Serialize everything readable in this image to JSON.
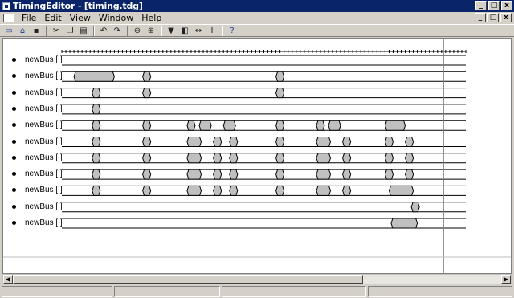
{
  "window": {
    "title": "TimingEditor - [timing.tdg]",
    "controls": [
      "_",
      "□",
      "x"
    ]
  },
  "menu": {
    "items": [
      {
        "first": "F",
        "rest": "ile"
      },
      {
        "first": "E",
        "rest": "dit"
      },
      {
        "first": "V",
        "rest": "iew"
      },
      {
        "first": "W",
        "rest": "indow"
      },
      {
        "first": "H",
        "rest": "elp"
      }
    ]
  },
  "toolbar": {
    "groups": [
      [
        {
          "name": "new-icon",
          "glyph": "▭"
        },
        {
          "name": "open-icon",
          "glyph": "⌂"
        },
        {
          "name": "save-icon",
          "glyph": "▪"
        }
      ],
      [
        {
          "name": "cut-icon",
          "glyph": "✂"
        },
        {
          "name": "copy-icon",
          "glyph": "❐"
        },
        {
          "name": "paste-icon",
          "glyph": "▤"
        }
      ],
      [
        {
          "name": "undo-icon",
          "glyph": "↶"
        },
        {
          "name": "redo-icon",
          "glyph": "↷"
        }
      ],
      [
        {
          "name": "zoom-out-icon",
          "glyph": "⊖"
        },
        {
          "name": "zoom-in-icon",
          "glyph": "⊕"
        }
      ],
      [
        {
          "name": "marker-down-icon",
          "glyph": "▼"
        },
        {
          "name": "add-signal-icon",
          "glyph": "◧"
        },
        {
          "name": "insert-time-icon",
          "glyph": "↔"
        },
        {
          "name": "text-cursor-icon",
          "glyph": "I"
        }
      ],
      [
        {
          "name": "help-icon",
          "glyph": "?"
        }
      ]
    ]
  },
  "signals": {
    "label": "newBus [ ]",
    "count": 11
  },
  "timeline": {
    "t_max": 100,
    "cursor_time": 94.5,
    "rows": [
      [],
      [
        [
          3,
          13
        ],
        [
          20,
          22
        ],
        [
          53,
          55
        ]
      ],
      [
        [
          7.5,
          9.5
        ],
        [
          20,
          22
        ],
        [
          53,
          55
        ]
      ],
      [
        [
          7.5,
          9.5
        ]
      ],
      [
        [
          7.5,
          9.5
        ],
        [
          20,
          22
        ],
        [
          31,
          33
        ],
        [
          34,
          37
        ],
        [
          40,
          43
        ],
        [
          53,
          55
        ],
        [
          63,
          65
        ],
        [
          66,
          69
        ],
        [
          80,
          85
        ]
      ],
      [
        [
          7.5,
          9.5
        ],
        [
          20,
          22
        ],
        [
          31,
          34.5
        ],
        [
          37.5,
          39.5
        ],
        [
          41.5,
          43.5
        ],
        [
          53,
          55
        ],
        [
          63,
          66.5
        ],
        [
          69.5,
          71.5
        ],
        [
          80,
          82
        ],
        [
          85,
          87
        ]
      ],
      [
        [
          7.5,
          9.5
        ],
        [
          20,
          22
        ],
        [
          31,
          34.5
        ],
        [
          37.5,
          39.5
        ],
        [
          41.5,
          43.5
        ],
        [
          53,
          55
        ],
        [
          63,
          66.5
        ],
        [
          69.5,
          71.5
        ],
        [
          80,
          82
        ],
        [
          85,
          87
        ]
      ],
      [
        [
          7.5,
          9.5
        ],
        [
          20,
          22
        ],
        [
          31,
          34.5
        ],
        [
          37.5,
          39.5
        ],
        [
          41.5,
          43.5
        ],
        [
          53,
          55
        ],
        [
          63,
          66.5
        ],
        [
          69.5,
          71.5
        ],
        [
          80,
          82
        ],
        [
          85,
          87
        ]
      ],
      [
        [
          7.5,
          9.5
        ],
        [
          20,
          22
        ],
        [
          31,
          34.5
        ],
        [
          37.5,
          39.5
        ],
        [
          41.5,
          43.5
        ],
        [
          53,
          55
        ],
        [
          63,
          66.5
        ],
        [
          69.5,
          71.5
        ],
        [
          81,
          87
        ]
      ],
      [
        [
          86.5,
          88.5
        ]
      ],
      [
        [
          81.5,
          88
        ]
      ]
    ]
  },
  "colors": {
    "titlebar": "#0a246a",
    "chrome": "#d4d0c8",
    "bus_fill": "#c0c0c0",
    "line": "#000000",
    "cursor_line": "#808080"
  }
}
